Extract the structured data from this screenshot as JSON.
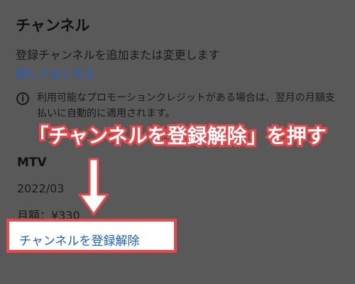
{
  "channel_section": {
    "title": "チャンネル",
    "description": "登録チャンネルを追加または変更します",
    "learn_more_link": "詳しくはこちら"
  },
  "info": {
    "icon": "info-icon",
    "text": "利用可能なプロモーションクレジットがある場合は、翌月の月額支払いに自動的に適用されます。"
  },
  "annotation": {
    "banner_text": "「チャンネルを登録解除」を押す",
    "color": "#e9474a"
  },
  "channel": {
    "name": "MTV",
    "date": "2022/03",
    "price": "月額：¥330"
  },
  "actions": {
    "unsubscribe_label": "チャンネルを登録解除"
  }
}
